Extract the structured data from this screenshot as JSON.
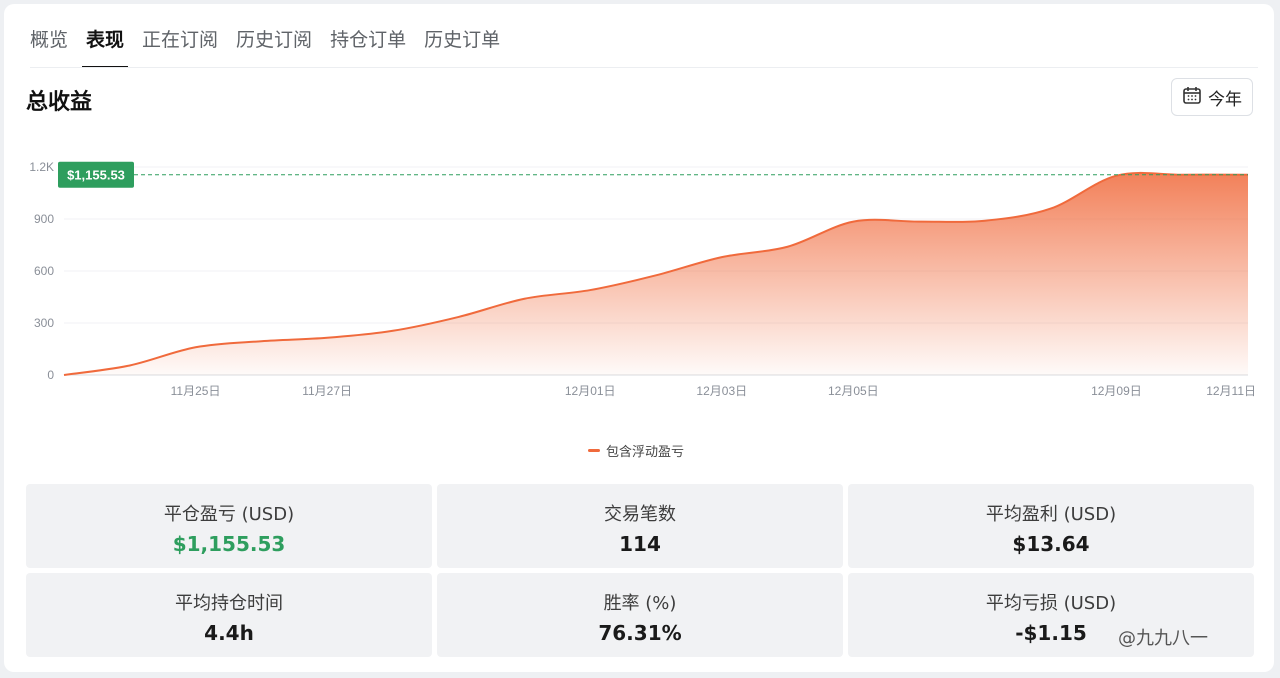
{
  "tabs": [
    "概览",
    "表现",
    "正在订阅",
    "历史订阅",
    "持仓订单",
    "历史订单"
  ],
  "active_tab": 1,
  "section_title": "总收益",
  "period_button": {
    "label": "今年",
    "icon": "calendar-icon"
  },
  "chart_data": {
    "type": "area",
    "x_tick_labels": [
      "11月25日",
      "11月27日",
      "12月01日",
      "12月03日",
      "12月05日",
      "12月09日",
      "12月11日"
    ],
    "y_ticks": [
      "0",
      "300",
      "600",
      "900",
      "1.2K"
    ],
    "ylim": [
      0,
      1200
    ],
    "series": [
      {
        "name": "包含浮动盈亏",
        "color": "#f06a3c",
        "x": [
          "11月23日",
          "11月24日",
          "11月25日",
          "11月26日",
          "11月27日",
          "11月28日",
          "11月29日",
          "11月30日",
          "12月01日",
          "12月02日",
          "12月03日",
          "12月04日",
          "12月05日",
          "12月06日",
          "12月07日",
          "12月08日",
          "12月09日",
          "12月10日",
          "12月11日"
        ],
        "values": [
          0,
          55,
          160,
          195,
          215,
          255,
          335,
          440,
          490,
          575,
          680,
          740,
          885,
          885,
          890,
          960,
          1150,
          1155.53,
          1155.53
        ]
      }
    ],
    "marker": {
      "value": 1155.53,
      "label": "$1,155.53",
      "color": "#2e9e5e"
    },
    "grid": true
  },
  "stats": [
    {
      "label": "平仓盈亏 (USD)",
      "value": "$1,155.53",
      "positive": true
    },
    {
      "label": "交易笔数",
      "value": "114"
    },
    {
      "label": "平均盈利 (USD)",
      "value": "$13.64"
    },
    {
      "label": "平均持仓时间",
      "value": "4.4h"
    },
    {
      "label": "胜率 (%)",
      "value": "76.31%"
    },
    {
      "label": "平均亏损 (USD)",
      "value": "-$1.15"
    }
  ],
  "watermark": "@九九八一"
}
